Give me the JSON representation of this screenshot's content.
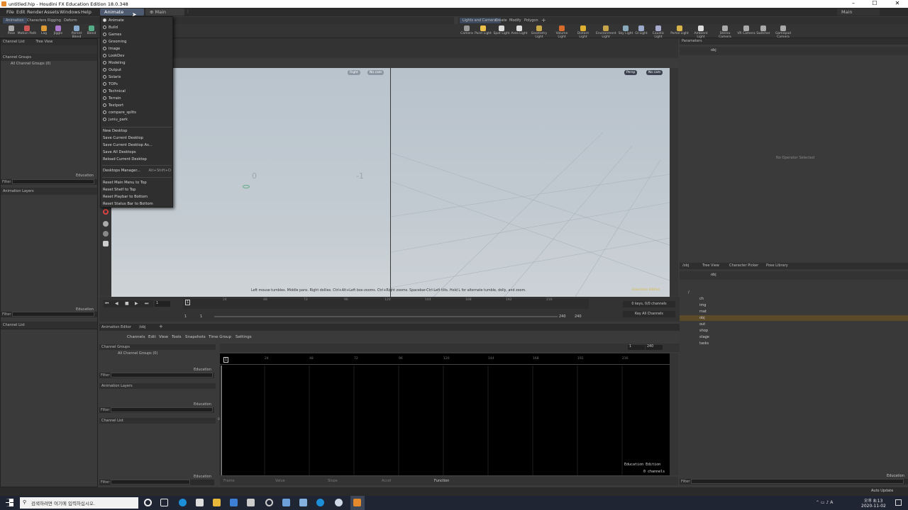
{
  "window": {
    "title": "untitled.hip - Houdini FX Education Edition 18.0.348"
  },
  "menubar": {
    "items": [
      "File",
      "Edit",
      "Render",
      "Assets",
      "Windows",
      "Help"
    ],
    "desktop_current": "Animate",
    "desktop_tab": "Main"
  },
  "shelf_tabs_left": [
    "Animation",
    "Characters",
    "Rigging",
    "Deform"
  ],
  "shelf_tools_left": [
    "Pose",
    "Motion Path",
    "Lag",
    "Jiggle",
    "Parent Blend",
    "Blend"
  ],
  "shelf_tabs_right": [
    "Lights and Cameras",
    "Create",
    "Modify",
    "Polygon"
  ],
  "shelf_tools_right": [
    "Camera",
    "Point Light",
    "Spot Light",
    "Area Light",
    "Geometry Light",
    "Volume Light",
    "Distant Light",
    "Environment Light",
    "Sky Light",
    "GI Light",
    "Caustic Light",
    "Portal Light",
    "Ambient Light",
    "Stereo Camera",
    "VR Camera",
    "Switcher",
    "Gamepad Camera"
  ],
  "desktop_menu": {
    "desktops": [
      "Animate",
      "Build",
      "Games",
      "Grooming",
      "Image",
      "LookDev",
      "Modeling",
      "Output",
      "Solaris",
      "TOPs",
      "Technical",
      "Terrain",
      "Textport",
      "compare_splits",
      "juniu_park"
    ],
    "actions": [
      "New Desktop",
      "Save Current Desktop",
      "Save Current Desktop As...",
      "Save All Desktops",
      "Reload Current Desktop"
    ],
    "manager": "Desktops Manager...",
    "manager_shortcut": "Alt+Shift+D",
    "resets": [
      "Reset Main Menu to Top",
      "Reset Shelf to Top",
      "Reset Playbar to Bottom",
      "Reset Status Bar to Bottom"
    ]
  },
  "left_top": {
    "tabs": [
      "Channel List",
      "Tree View"
    ],
    "channel_groups": "Channel Groups",
    "all_groups": "All Channel Groups (0)",
    "edu": "Education",
    "filter": "Filter",
    "anim_layers": "Animation Layers",
    "edu2": "Education",
    "filter2": "Filter",
    "channel_list": "Channel List"
  },
  "viewport": {
    "left_view": "Right",
    "left_cam": "No cam",
    "right_view": "Persp",
    "right_cam": "No cam",
    "tick0": "0",
    "tickm1": "-1",
    "hint": "Left mouse tumbles. Middle pans. Right dollies. Ctrl+Alt+Left box-zooms. Ctrl+Right zooms. Spacebar-Ctrl-Left tilts. Hold L for alternate tumble, dolly, and zoom.",
    "edu": "Education Edition"
  },
  "timeline": {
    "frame": "1",
    "start": "1",
    "start2": "1",
    "end": "240",
    "end2": "240",
    "ticks": [
      "24",
      "48",
      "72",
      "96",
      "120",
      "144",
      "168",
      "192",
      "216"
    ],
    "keys": "0 keys, 0/0 channels",
    "key_all": "Key All Channels"
  },
  "anim_editor": {
    "tabs": [
      "Animation Editor",
      "/obj"
    ],
    "menu": [
      "Channels",
      "Edit",
      "View",
      "Tools",
      "Snapshots",
      "Time Group",
      "Settings"
    ],
    "channel_groups": "Channel Groups",
    "all_groups": "All Channel Groups (0)",
    "edu": "Education",
    "filter": "Filter",
    "anim_layers": "Animation Layers",
    "edu2": "Education",
    "filter2": "Filter",
    "channel_list": "Channel List",
    "edu3": "Education",
    "filter3": "Filter",
    "range_start": "1",
    "range_end": "240",
    "ticks": [
      "24",
      "48",
      "72",
      "96",
      "120",
      "144",
      "168",
      "192",
      "216"
    ],
    "zero": "0",
    "edu_ed": "Education Edition",
    "channels": "0 channels",
    "cols": [
      "Frame",
      "Value",
      "Slope",
      "Accel",
      "Function"
    ]
  },
  "parameters": {
    "tab": "Parameters",
    "path": "obj",
    "none": "No Operator Selected"
  },
  "network": {
    "tabs": [
      "/obj",
      "Tree View",
      "Character Picker",
      "Pose Library"
    ],
    "path": "obj",
    "tree": [
      "/",
      "ch",
      "img",
      "mat",
      "obj",
      "out",
      "shop",
      "stage",
      "tasks"
    ],
    "edu": "Education",
    "filter": "Filter"
  },
  "statusbar": {
    "auto": "Auto Update"
  },
  "taskbar": {
    "search": "검색하려면 여기에 입력하십시오.",
    "time": "오후 8:13",
    "date": "2020-11-02"
  }
}
